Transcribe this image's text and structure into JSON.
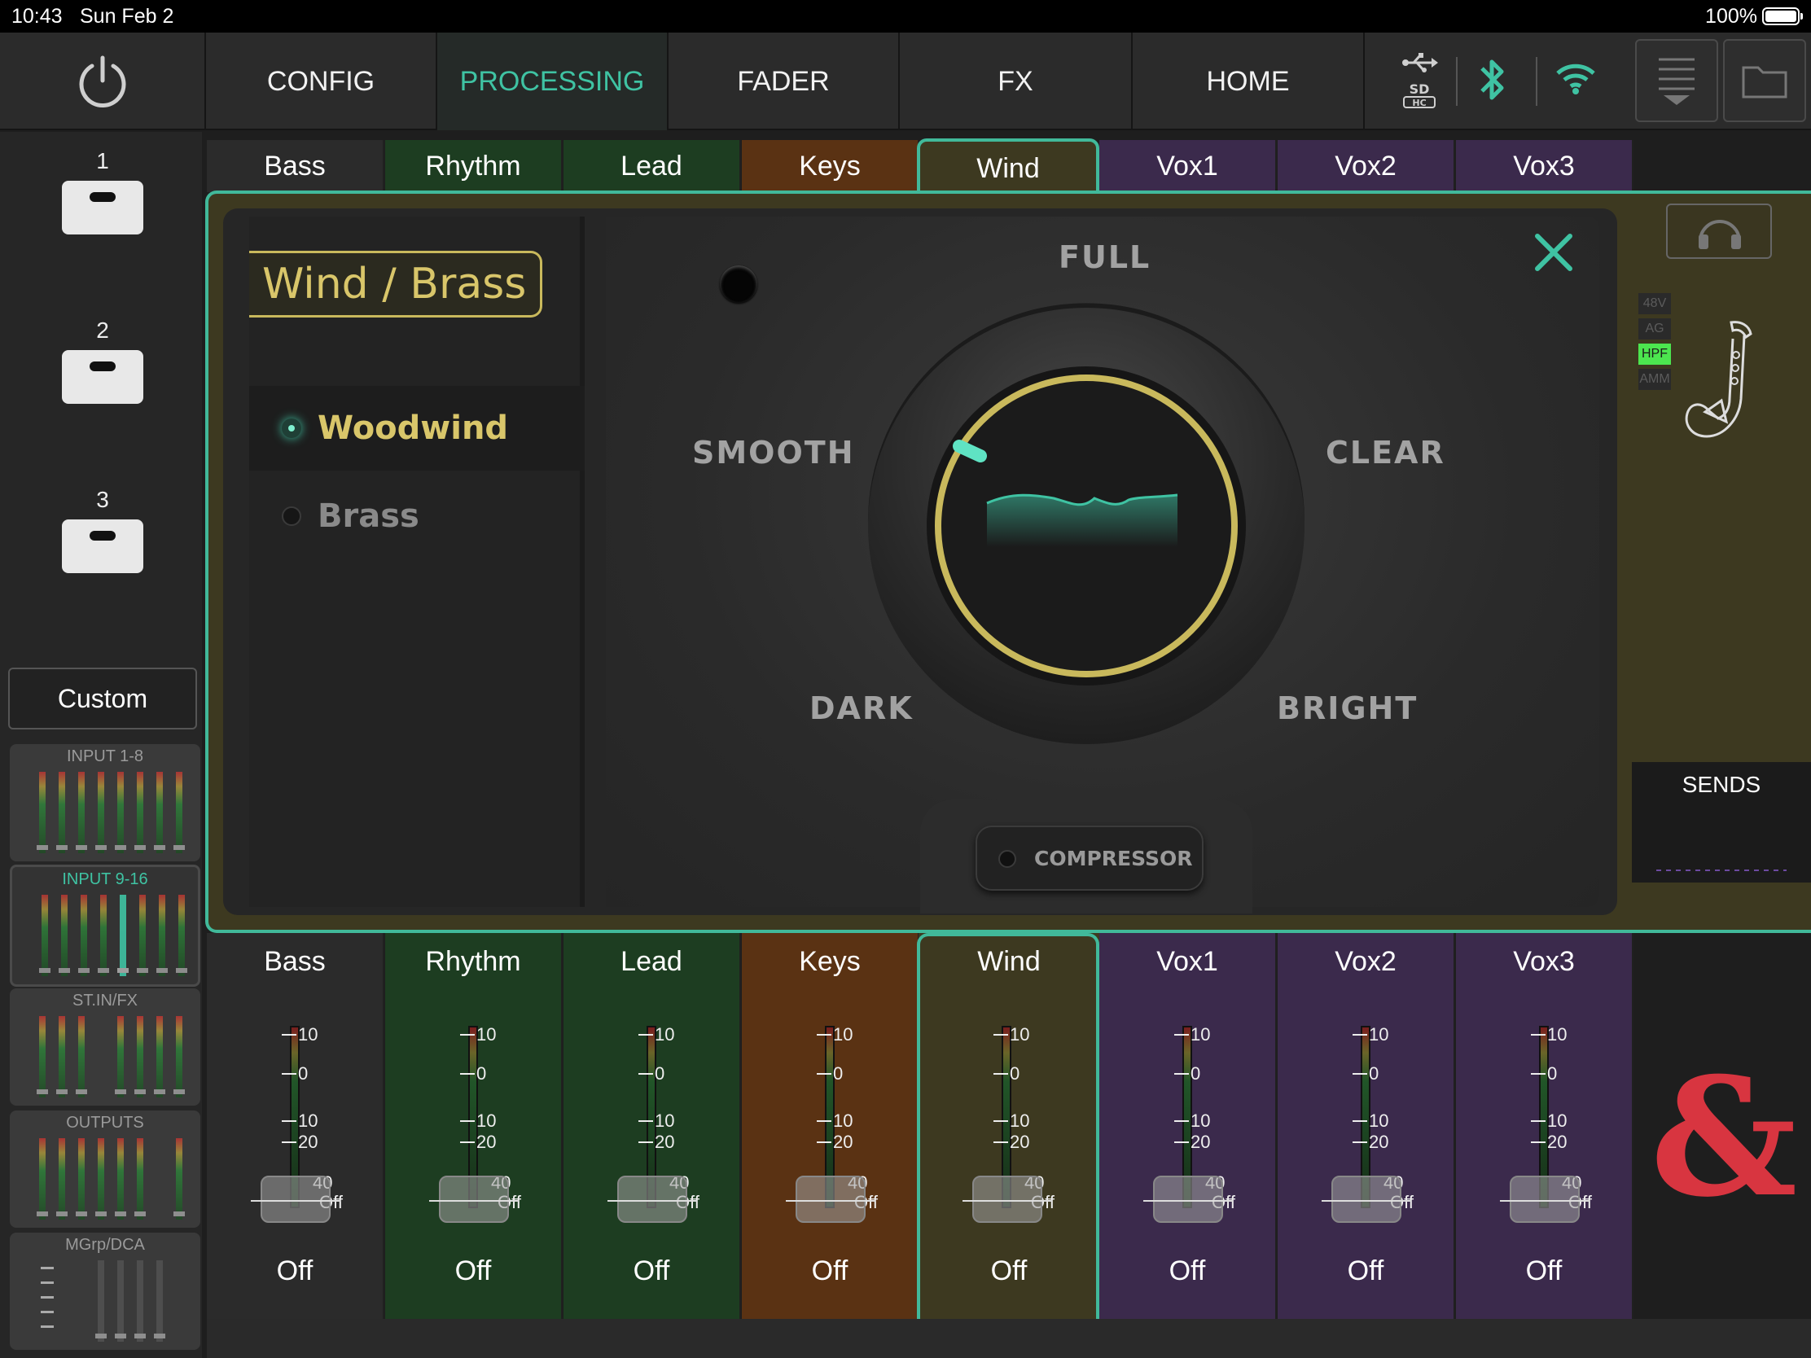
{
  "status_bar": {
    "time": "10:43",
    "date": "Sun Feb 2",
    "battery": "100%"
  },
  "nav": {
    "tabs": [
      {
        "label": "CONFIG",
        "active": false
      },
      {
        "label": "PROCESSING",
        "active": true
      },
      {
        "label": "FADER",
        "active": false
      },
      {
        "label": "FX",
        "active": false
      },
      {
        "label": "HOME",
        "active": false
      }
    ],
    "icons": [
      "usb-icon",
      "sd-card-icon",
      "bluetooth-icon",
      "wifi-icon",
      "menu-icon",
      "folder-icon"
    ],
    "accent_color": "#3fc3a3"
  },
  "sidebar": {
    "scenes": [
      {
        "number": "1"
      },
      {
        "number": "2"
      },
      {
        "number": "3"
      }
    ],
    "custom_label": "Custom",
    "banks": [
      {
        "title": "INPUT 1-8",
        "active": false
      },
      {
        "title": "INPUT 9-16",
        "active": true
      },
      {
        "title": "ST.IN/FX",
        "active": false
      },
      {
        "title": "OUTPUTS",
        "active": false
      },
      {
        "title": "MGrp/DCA",
        "active": false
      }
    ]
  },
  "channels": [
    {
      "name": "Bass",
      "color": "#2b2b2b",
      "level": "Off"
    },
    {
      "name": "Rhythm",
      "color": "#1d3d21",
      "level": "Off"
    },
    {
      "name": "Lead",
      "color": "#1d3d21",
      "level": "Off"
    },
    {
      "name": "Keys",
      "color": "#5a3213",
      "level": "Off"
    },
    {
      "name": "Wind",
      "color": "#3d3920",
      "level": "Off"
    },
    {
      "name": "Vox1",
      "color": "#3b2a4c",
      "level": "Off"
    },
    {
      "name": "Vox2",
      "color": "#3b2a4c",
      "level": "Off"
    },
    {
      "name": "Vox3",
      "color": "#3b2a4c",
      "level": "Off"
    }
  ],
  "selected_channel": "Wind",
  "editor": {
    "preset_title": "Wind / Brass",
    "presets": [
      {
        "label": "Woodwind",
        "selected": true
      },
      {
        "label": "Brass",
        "selected": false
      }
    ],
    "labels": {
      "full": "FULL",
      "smooth": "SMOOTH",
      "clear": "CLEAR",
      "dark": "DARK",
      "bright": "BRIGHT"
    },
    "compressor_label": "COMPRESSOR",
    "knob_ring_color": "#c9b95c"
  },
  "right_panel": {
    "badges": [
      {
        "label": "48V",
        "on": false
      },
      {
        "label": "AG",
        "on": false
      },
      {
        "label": "HPF",
        "on": true
      },
      {
        "label": "AMM",
        "on": false
      }
    ],
    "instrument_icon": "saxophone-icon",
    "sends_label": "SENDS",
    "logo_text": "&"
  },
  "fader_scale": [
    "10",
    "0",
    "10",
    "20",
    "40",
    "Off"
  ]
}
